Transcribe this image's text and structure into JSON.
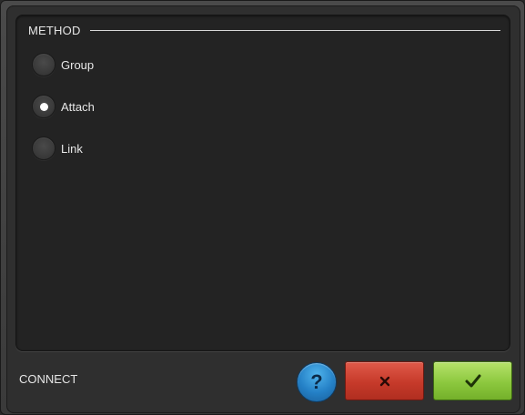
{
  "method_section": {
    "title": "METHOD",
    "options": [
      {
        "label": "Group",
        "checked": false
      },
      {
        "label": "Attach",
        "checked": true
      },
      {
        "label": "Link",
        "checked": false
      }
    ]
  },
  "footer": {
    "label": "CONNECT",
    "help_glyph": "?",
    "help_icon": "help-icon",
    "cancel_icon": "close-icon",
    "confirm_icon": "checkmark-icon"
  },
  "colors": {
    "help_button": "#2480c6",
    "cancel_button": "#c63a2a",
    "confirm_button": "#8cc83e"
  }
}
